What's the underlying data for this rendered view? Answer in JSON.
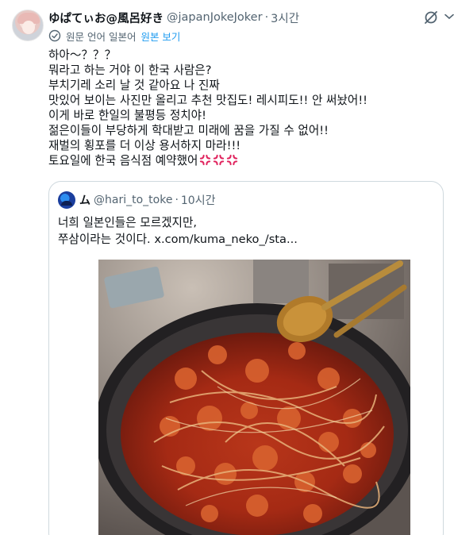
{
  "post": {
    "display_name": "ゆぱてぃお@風呂好き",
    "handle": "@japanJokeJoker",
    "separator": "·",
    "time": "3시간",
    "translation_info": "원문 언어 일본어",
    "show_original": "원본 보기",
    "lines": [
      "하아～？？？",
      "뭐라고 하는 거야 이 한국 사람은?",
      "부치기레 소리 날 것 같아요 나 진짜",
      "맛있어 보이는 사진만 올리고 추천 맛집도! 레시피도!! 안 써놨어!!",
      "이게 바로 한일의 불평등 정치야!",
      "젊은이들이 부당하게 학대받고 미래에 꿈을 가질 수 없어!!",
      "재벌의 횡포를 더 이상 용서하지 마라!!!",
      "토요일에 한국 음식점 예약했어"
    ],
    "trailing_emoji": "💢💢💢"
  },
  "quote": {
    "display_name": "ム",
    "handle": "@hari_to_toke",
    "separator": "·",
    "time": "10시간",
    "lines": [
      "너희 일본인들은 모르겠지만,",
      "쭈삼이라는 것이다. x.com/kuma_neko_/sta..."
    ]
  },
  "icons": {
    "grok": "grok-icon",
    "more": "chevron-down-icon",
    "translate": "translate-icon",
    "anger": "anger-symbol-icon"
  },
  "colors": {
    "text": "#0f1419",
    "muted": "#536471",
    "link": "#1d9bf0",
    "border": "#cfd9de"
  }
}
